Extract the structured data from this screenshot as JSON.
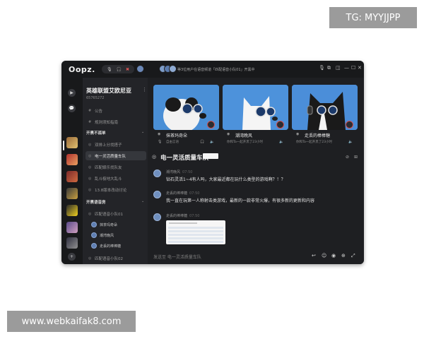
{
  "watermarks": {
    "top": "TG: MYYJJPP",
    "bottom": "www.webkaifak8.com"
  },
  "titlebar": {
    "logo": "Oopz.",
    "voice_controls": [
      "🎙",
      "🎧",
      "✖"
    ],
    "online_text": "等3位用户在语音频道「匹配语音小队01」开黑中",
    "window_controls": [
      "🎙",
      "⧉",
      "◫",
      "—",
      "☐",
      "✕"
    ]
  },
  "rail": {
    "top_icons": [
      "▶",
      "💬"
    ],
    "bottom_icon": "+"
  },
  "sidebar": {
    "server_name": "英雄联盟艾欧尼亚",
    "server_id": "65765272",
    "top_channels": [
      {
        "label": "公告",
        "icon": "#"
      },
      {
        "label": "规则须知指南",
        "icon": "#"
      }
    ],
    "groups": [
      {
        "label": "开黑不孤单",
        "channels": [
          {
            "label": "双排上分找搭子",
            "icon": "◎",
            "active": false
          },
          {
            "label": "电一灵活质量车队",
            "icon": "◎",
            "active": true
          },
          {
            "label": "匹配娱乐找队友",
            "icon": "◎",
            "active": false
          },
          {
            "label": "乱斗极地大乱斗",
            "icon": "◎",
            "active": false
          },
          {
            "label": "13.8版本改动讨论",
            "icon": "◎",
            "active": false
          }
        ]
      },
      {
        "label": "开黑语音房",
        "channels": [
          {
            "label": "匹配语音小队01",
            "icon": "◎"
          }
        ],
        "members": [
          "抹茶玛奇朵",
          "潮湾晚风",
          "走丢的棒棒糖"
        ],
        "more": "匹配语音小队02"
      }
    ]
  },
  "cards": [
    {
      "name": "抹茶玛奇朵",
      "sub": "自由言语",
      "color": "#4a8fd6"
    },
    {
      "name": "潮湾晚风",
      "sub": "你和Ta一起开黑了23小时",
      "color": "#4d92db"
    },
    {
      "name": "走丢的棒棒糖",
      "sub": "你和Ta一起开黑了23小时",
      "color": "#4b8ed9"
    }
  ],
  "chat": {
    "title": "电一灵活质量车队",
    "messages": [
      {
        "name": "潮湾晚风",
        "time": "07:50",
        "text": "钻石灵活1~4有人吗，大家最近都在玩什么类型的游戏啊？！？"
      },
      {
        "name": "走丢的棒棒糖",
        "time": "07:50",
        "text": "我一直在玩第一人称射击类游戏，最新的一款非常火爆，有很多新的更新和内容"
      },
      {
        "name": "走丢的棒棒糖",
        "time": "07:50",
        "text": ""
      }
    ],
    "input_placeholder": "发送至 电一灵活质量车队",
    "input_icons": [
      "↩",
      "☺",
      "◉",
      "⊕",
      "⤢"
    ]
  },
  "colors": {
    "window_bg": "#1e1f22",
    "sidebar_bg": "#232428",
    "card_blue": "#4a8fd6",
    "accent_red": "#d05050"
  }
}
